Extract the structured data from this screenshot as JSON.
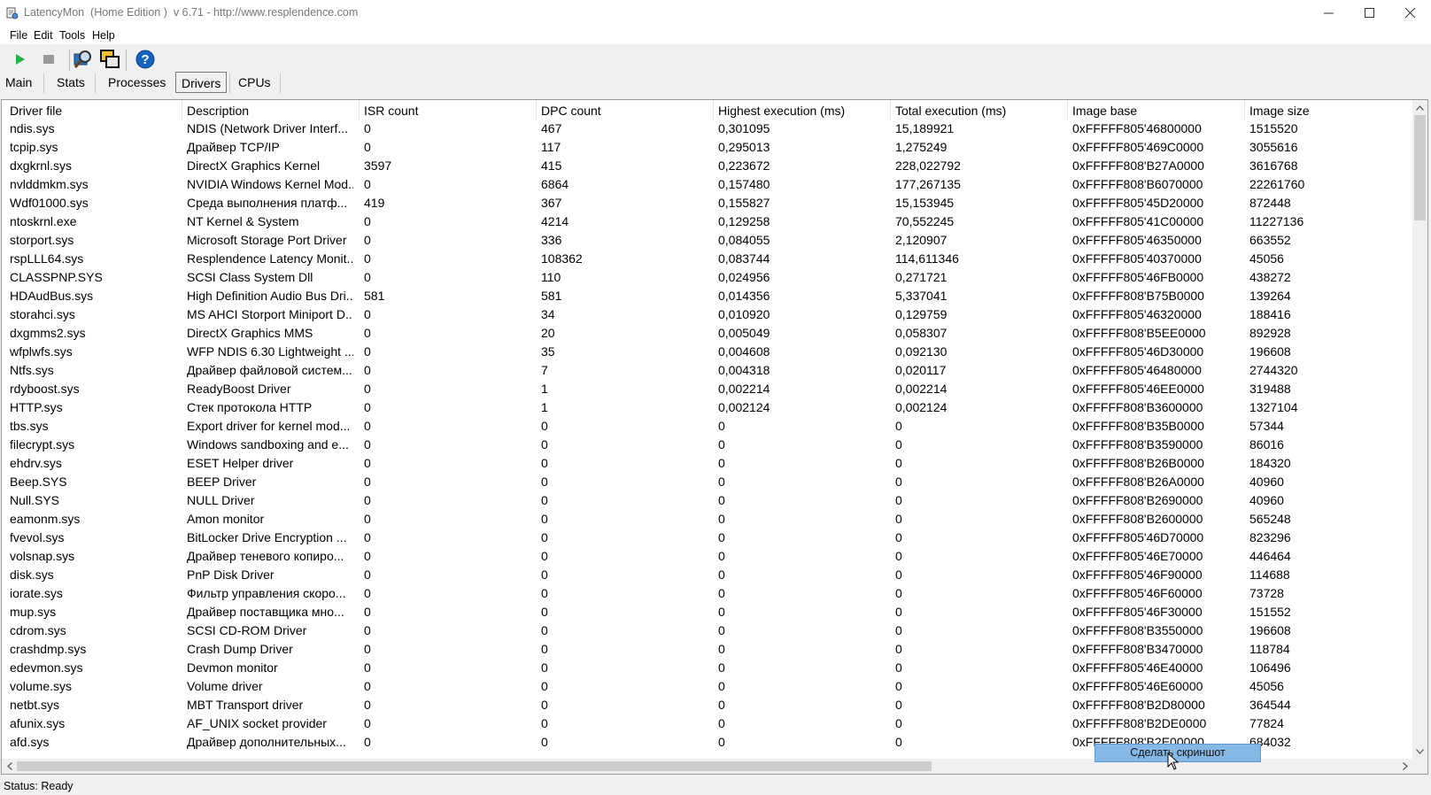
{
  "window": {
    "title": "LatencyMon  (Home Edition )  v 6.71 - http://www.resplendence.com"
  },
  "menu": [
    "File",
    "Edit",
    "Tools",
    "Help"
  ],
  "tabs": [
    "Main",
    "Stats",
    "Processes",
    "Drivers",
    "CPUs"
  ],
  "active_tab": "Drivers",
  "columns": [
    "Driver file",
    "Description",
    "ISR count",
    "DPC count",
    "Highest execution (ms)",
    "Total execution (ms)",
    "Image base",
    "Image size"
  ],
  "rows": [
    [
      "ndis.sys",
      "NDIS (Network Driver Interf...",
      "0",
      "467",
      "0,301095",
      "15,189921",
      "0xFFFFF805'46800000",
      "1515520"
    ],
    [
      "tcpip.sys",
      "Драйвер TCP/IP",
      "0",
      "117",
      "0,295013",
      "1,275249",
      "0xFFFFF805'469C0000",
      "3055616"
    ],
    [
      "dxgkrnl.sys",
      "DirectX Graphics Kernel",
      "3597",
      "415",
      "0,223672",
      "228,022792",
      "0xFFFFF808'B27A0000",
      "3616768"
    ],
    [
      "nvlddmkm.sys",
      "NVIDIA Windows Kernel Mod...",
      "0",
      "6864",
      "0,157480",
      "177,267135",
      "0xFFFFF808'B6070000",
      "22261760"
    ],
    [
      "Wdf01000.sys",
      "Среда выполнения платф...",
      "419",
      "367",
      "0,155827",
      "15,153945",
      "0xFFFFF805'45D20000",
      "872448"
    ],
    [
      "ntoskrnl.exe",
      "NT Kernel & System",
      "0",
      "4214",
      "0,129258",
      "70,552245",
      "0xFFFFF805'41C00000",
      "11227136"
    ],
    [
      "storport.sys",
      "Microsoft Storage Port Driver",
      "0",
      "336",
      "0,084055",
      "2,120907",
      "0xFFFFF805'46350000",
      "663552"
    ],
    [
      "rspLLL64.sys",
      "Resplendence Latency Monit...",
      "0",
      "108362",
      "0,083744",
      "114,611346",
      "0xFFFFF805'40370000",
      "45056"
    ],
    [
      "CLASSPNP.SYS",
      "SCSI Class System Dll",
      "0",
      "110",
      "0,024956",
      "0,271721",
      "0xFFFFF805'46FB0000",
      "438272"
    ],
    [
      "HDAudBus.sys",
      "High Definition Audio Bus Dri...",
      "581",
      "581",
      "0,014356",
      "5,337041",
      "0xFFFFF808'B75B0000",
      "139264"
    ],
    [
      "storahci.sys",
      "MS AHCI Storport Miniport D...",
      "0",
      "34",
      "0,010920",
      "0,129759",
      "0xFFFFF805'46320000",
      "188416"
    ],
    [
      "dxgmms2.sys",
      "DirectX Graphics MMS",
      "0",
      "20",
      "0,005049",
      "0,058307",
      "0xFFFFF808'B5EE0000",
      "892928"
    ],
    [
      "wfplwfs.sys",
      "WFP NDIS 6.30 Lightweight ...",
      "0",
      "35",
      "0,004608",
      "0,092130",
      "0xFFFFF805'46D30000",
      "196608"
    ],
    [
      "Ntfs.sys",
      "Драйвер файловой систем...",
      "0",
      "7",
      "0,004318",
      "0,020117",
      "0xFFFFF805'46480000",
      "2744320"
    ],
    [
      "rdyboost.sys",
      "ReadyBoost Driver",
      "0",
      "1",
      "0,002214",
      "0,002214",
      "0xFFFFF805'46EE0000",
      "319488"
    ],
    [
      "HTTP.sys",
      "Стек протокола HTTP",
      "0",
      "1",
      "0,002124",
      "0,002124",
      "0xFFFFF808'B3600000",
      "1327104"
    ],
    [
      "tbs.sys",
      "Export driver for kernel mod...",
      "0",
      "0",
      "0",
      "0",
      "0xFFFFF808'B35B0000",
      "57344"
    ],
    [
      "filecrypt.sys",
      "Windows sandboxing and e...",
      "0",
      "0",
      "0",
      "0",
      "0xFFFFF808'B3590000",
      "86016"
    ],
    [
      "ehdrv.sys",
      "ESET Helper driver",
      "0",
      "0",
      "0",
      "0",
      "0xFFFFF808'B26B0000",
      "184320"
    ],
    [
      "Beep.SYS",
      "BEEP Driver",
      "0",
      "0",
      "0",
      "0",
      "0xFFFFF808'B26A0000",
      "40960"
    ],
    [
      "Null.SYS",
      "NULL Driver",
      "0",
      "0",
      "0",
      "0",
      "0xFFFFF808'B2690000",
      "40960"
    ],
    [
      "eamonm.sys",
      "Amon monitor",
      "0",
      "0",
      "0",
      "0",
      "0xFFFFF808'B2600000",
      "565248"
    ],
    [
      "fvevol.sys",
      "BitLocker Drive Encryption ...",
      "0",
      "0",
      "0",
      "0",
      "0xFFFFF805'46D70000",
      "823296"
    ],
    [
      "volsnap.sys",
      "Драйвер теневого копиро...",
      "0",
      "0",
      "0",
      "0",
      "0xFFFFF805'46E70000",
      "446464"
    ],
    [
      "disk.sys",
      "PnP Disk Driver",
      "0",
      "0",
      "0",
      "0",
      "0xFFFFF805'46F90000",
      "114688"
    ],
    [
      "iorate.sys",
      "Фильтр управления скоро...",
      "0",
      "0",
      "0",
      "0",
      "0xFFFFF805'46F60000",
      "73728"
    ],
    [
      "mup.sys",
      "Драйвер поставщика мно...",
      "0",
      "0",
      "0",
      "0",
      "0xFFFFF805'46F30000",
      "151552"
    ],
    [
      "cdrom.sys",
      "SCSI CD-ROM Driver",
      "0",
      "0",
      "0",
      "0",
      "0xFFFFF808'B3550000",
      "196608"
    ],
    [
      "crashdmp.sys",
      "Crash Dump Driver",
      "0",
      "0",
      "0",
      "0",
      "0xFFFFF808'B3470000",
      "118784"
    ],
    [
      "edevmon.sys",
      "Devmon monitor",
      "0",
      "0",
      "0",
      "0",
      "0xFFFFF805'46E40000",
      "106496"
    ],
    [
      "volume.sys",
      "Volume driver",
      "0",
      "0",
      "0",
      "0",
      "0xFFFFF805'46E60000",
      "45056"
    ],
    [
      "netbt.sys",
      "MBT Transport driver",
      "0",
      "0",
      "0",
      "0",
      "0xFFFFF808'B2D80000",
      "364544"
    ],
    [
      "afunix.sys",
      "AF_UNIX socket provider",
      "0",
      "0",
      "0",
      "0",
      "0xFFFFF808'B2DE0000",
      "77824"
    ],
    [
      "afd.sys",
      "Драйвер дополнительных...",
      "0",
      "0",
      "0",
      "0",
      "0xFFFFF808'B2E00000",
      "684032"
    ]
  ],
  "tooltip": "Сделать скриншот",
  "status": "Status: Ready",
  "icons": {
    "start": "play-icon",
    "stop": "stop-icon",
    "search": "magnifier-icon",
    "windows": "windows-icon",
    "help": "help-icon"
  },
  "colors": {
    "play": "#22b14c",
    "help": "#1565c0",
    "tooltip": "#86b8e6"
  }
}
